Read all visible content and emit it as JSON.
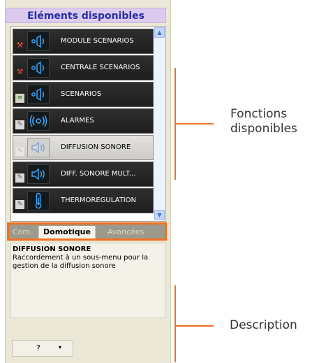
{
  "panel": {
    "title": "Eléments disponibles"
  },
  "list": {
    "items": [
      {
        "label": "MODULE SCENARIOS",
        "status_icon": "tool-icon",
        "icon": "speaker-icon",
        "selected": false
      },
      {
        "label": "CENTRALE SCENARIOS",
        "status_icon": "tool-icon",
        "icon": "speaker-icon",
        "selected": false
      },
      {
        "label": "SCENARIOS",
        "status_icon": "doc-icon",
        "icon": "speaker-icon",
        "selected": false
      },
      {
        "label": "ALARMES",
        "status_icon": "pencil-icon",
        "icon": "alarm-icon",
        "selected": false
      },
      {
        "label": "DIFFUSION SONORE",
        "status_icon": "pencil-icon",
        "icon": "sound-icon",
        "selected": true
      },
      {
        "label": "DIFF. SONORE MULT...",
        "status_icon": "pencil-icon",
        "icon": "sound-icon",
        "selected": false
      },
      {
        "label": "THERMOREGULATION",
        "status_icon": "pencil-icon",
        "icon": "thermometer-icon",
        "selected": false
      }
    ]
  },
  "tabs": [
    {
      "label": "Com.",
      "active": false
    },
    {
      "label": "Domotique",
      "active": true
    },
    {
      "label": "Avancées",
      "active": false
    }
  ],
  "description": {
    "title": "DIFFUSION SONORE",
    "body": "Raccordement à un sous-menu pour la gestion de la diffusion sonore"
  },
  "help_button": {
    "label": "?",
    "arrow": "▾"
  },
  "annotations": {
    "functions_label_line1": "Fonctions",
    "functions_label_line2": "disponibles",
    "description_label": "Description"
  },
  "colors": {
    "callout": "#f26f21",
    "title_bg": "#dccbef",
    "title_text": "#2b2ea3"
  }
}
